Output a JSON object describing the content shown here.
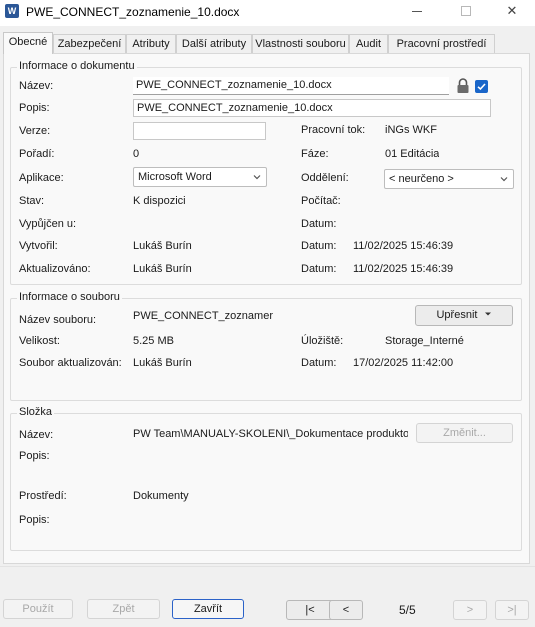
{
  "window": {
    "title": "PWE_CONNECT_zoznamenie_10.docx",
    "app_icon_letter": "W",
    "minimize": "─",
    "maximize": "☐",
    "close": "✕"
  },
  "tabs": [
    "Obecné",
    "Zabezpečení",
    "Atributy",
    "Další atributy",
    "Vlastnosti souboru",
    "Audit",
    "Pracovní prostředí"
  ],
  "doc_info": {
    "title": "Informace o dokumentu",
    "name_label": "Název:",
    "name_value": "PWE_CONNECT_zoznamenie_10.docx",
    "desc_label": "Popis:",
    "desc_value": "PWE_CONNECT_zoznamenie_10.docx",
    "version_label": "Verze:",
    "version_value": "",
    "order_label": "Pořadí:",
    "order_value": "0",
    "app_label": "Aplikace:",
    "app_value": "Microsoft Word",
    "state_label": "Stav:",
    "state_value": "K dispozici",
    "checked_out_label": "Vypůjčen u:",
    "checked_out_value": "",
    "created_label": "Vytvořil:",
    "created_value": "Lukáš Burín",
    "updated_label": "Aktualizováno:",
    "updated_value": "Lukáš Burín",
    "workflow_label": "Pracovní tok:",
    "workflow_value": "iNGs WKF",
    "phase_label": "Fáze:",
    "phase_value": "01 Editácia",
    "dept_label": "Oddělení:",
    "dept_value": "< neurčeno >",
    "computer_label": "Počítač:",
    "computer_value": "",
    "date1_label": "Datum:",
    "date1_value": "",
    "date2_label": "Datum:",
    "date2_value": "11/02/2025 15:46:39",
    "date3_label": "Datum:",
    "date3_value": "11/02/2025 15:46:39"
  },
  "file_info": {
    "title": "Informace o souboru",
    "filename_label": "Název souboru:",
    "filename_value": "PWE_CONNECT_zoznamer",
    "refine_button": "Upřesnit",
    "size_label": "Velikost:",
    "size_value": "5.25 MB",
    "storage_label": "Úložiště:",
    "storage_value": "Storage_Interné",
    "updated_label": "Soubor aktualizován:",
    "updated_value": "Lukáš Burín",
    "date_label": "Datum:",
    "date_value": "17/02/2025 11:42:00"
  },
  "folder": {
    "title": "Složka",
    "name_label": "Název:",
    "name_value": "PW Team\\MANUALY-SKOLENI\\_Dokumentace produkto",
    "change_button": "Změnit...",
    "desc_label": "Popis:",
    "desc_value": "",
    "env_label": "Prostředí:",
    "env_value": "Dokumenty",
    "env_desc_label": "Popis:",
    "env_desc_value": ""
  },
  "footer": {
    "apply": "Použít",
    "undo": "Zpět",
    "close": "Zavřít",
    "first": "|<",
    "prev": "<",
    "page": "5/5",
    "next": ">",
    "last": ">|"
  },
  "colors": {
    "accent": "#1a66c9",
    "word_blue": "#2b5797"
  }
}
